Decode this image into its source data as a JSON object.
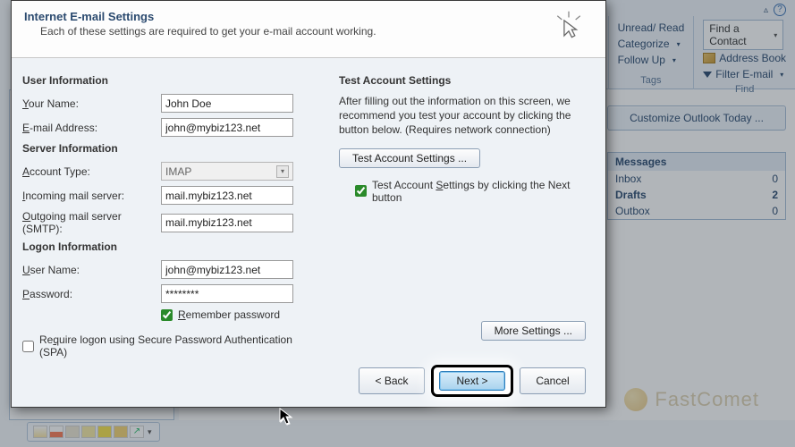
{
  "bg": {
    "ribbon": {
      "tags_group": {
        "label": "Tags",
        "unread_read": "Unread/ Read",
        "categorize": "Categorize",
        "follow_up": "Follow Up"
      },
      "find_group": {
        "label": "Find",
        "find_contact": "Find a Contact",
        "address_book": "Address Book",
        "filter_email": "Filter E-mail"
      }
    },
    "customize_btn": "Customize Outlook Today ...",
    "messages": {
      "header": "Messages",
      "rows": [
        {
          "name": "Inbox",
          "count": "0",
          "bold": false
        },
        {
          "name": "Drafts",
          "count": "2",
          "bold": true
        },
        {
          "name": "Outbox",
          "count": "0",
          "bold": false
        }
      ]
    }
  },
  "dialog": {
    "title": "Internet E-mail Settings",
    "subtitle": "Each of these settings are required to get your e-mail account working.",
    "user_info_h": "User Information",
    "your_name_label_pre": "",
    "your_name_u": "Y",
    "your_name_label_post": "our Name:",
    "your_name_value": "John Doe",
    "email_label_u": "E",
    "email_label_post": "-mail Address:",
    "email_value": "john@mybiz123.net",
    "server_info_h": "Server Information",
    "account_type_u": "A",
    "account_type_post": "ccount Type:",
    "account_type_value": "IMAP",
    "incoming_u": "I",
    "incoming_post": "ncoming mail server:",
    "incoming_value": "mail.mybiz123.net",
    "outgoing_u": "O",
    "outgoing_post": "utgoing mail server (SMTP):",
    "outgoing_value": "mail.mybiz123.net",
    "logon_info_h": "Logon Information",
    "username_u": "U",
    "username_post": "ser Name:",
    "username_value": "john@mybiz123.net",
    "password_u": "P",
    "password_post": "assword:",
    "password_value": "********",
    "remember_u": "R",
    "remember_post": "emember password",
    "spa_pre": "Re",
    "spa_u": "q",
    "spa_post": "uire logon using Secure Password Authentication (SPA)",
    "test_h": "Test Account Settings",
    "test_desc": "After filling out the information on this screen, we recommend you test your account by clicking the button below. (Requires network connection)",
    "test_btn_u": "T",
    "test_btn_post": "est Account Settings ...",
    "test_chk_pre": "Test Account ",
    "test_chk_u": "S",
    "test_chk_post": "ettings by clicking the Next button",
    "more_settings_u": "M",
    "more_settings_post": "ore Settings ...",
    "back_btn": "< ",
    "back_u": "B",
    "back_post": "ack",
    "next_u": "N",
    "next_post": "ext >",
    "cancel": "Cancel"
  },
  "watermark": "FastComet"
}
